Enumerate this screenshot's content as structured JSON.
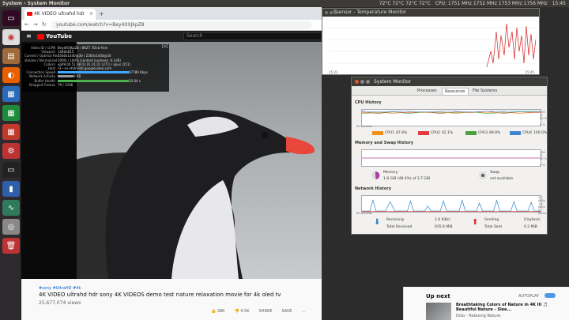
{
  "topbar": {
    "title": "System › System Monitor",
    "tray": [
      "72°C 72°C 72°C 72°C",
      "CPU: 1751 MHz 1752 MHz 1753 MHz 1756 MHz",
      "15:45"
    ]
  },
  "launcher": {
    "items": [
      "terminal",
      "chrome",
      "files",
      "firefox",
      "libreoffice-writer",
      "libreoffice-calc",
      "libreoffice-impress",
      "settings",
      "terminal-2",
      "sysmon",
      "terminal-3",
      "camera",
      "trash"
    ]
  },
  "browser": {
    "tab_title": "4K VIDEO ultrahd hdr",
    "url": "youtube.com/watch?v=Bey4XXJkpZ8",
    "yt_logo": "YouTube",
    "search_placeholder": "Search",
    "stats": [
      {
        "k": "Video ID / sCPN",
        "v": "Bey4XXJkpZ8 / 8KZT 7Dnb 9nm"
      },
      {
        "k": "Viewport",
        "v": "1440x815"
      },
      {
        "k": "Current / Optimal Res",
        "v": "2560x1440@30 / 2560x1440@30"
      },
      {
        "k": "Volume / Normalized",
        "v": "100% / 100% (content loudness -0.1dB)"
      },
      {
        "k": "Codecs",
        "v": "vp09.00.51.08.01.01.01.01 (271) / opus (251)"
      },
      {
        "k": "Host",
        "v": "r3---sn-xfxtn-9jtl.googlevideo.com"
      },
      {
        "k": "Connection Speed",
        "v": "97789 Kbps"
      },
      {
        "k": "Network Activity",
        "v": "0 KB"
      },
      {
        "k": "Buffer Health",
        "v": "30.84 s"
      },
      {
        "k": "Dropped Frames",
        "v": "79 / 1336"
      }
    ],
    "tags": "#sony #UltraHD #4k",
    "video_title": "4K VIDEO ultrahd hdr sony 4K VIDEOS demo test nature relaxation movie for 4k oled tv",
    "views": "25,677,074 views",
    "actions": [
      "👍 38K",
      "👎 4.5K",
      "SHARE",
      "SAVE",
      "..."
    ],
    "upnext": {
      "header": "Up next",
      "autoplay": "AUTOPLAY",
      "title": "Breathtaking Colors of Nature in 4K III 🎵 Beautiful Nature - Slee...",
      "channel": "Dolo - Relaxing Nature"
    }
  },
  "psensor": {
    "title": "Psensor - Temperature Monitor",
    "time_start": "15:21",
    "time_end": "15:45"
  },
  "sysmon": {
    "title": "System Monitor",
    "tabs": [
      "Processes",
      "Resources",
      "File Systems"
    ],
    "active_tab": "Resources",
    "cpu_section": "CPU History",
    "cpu_axis": [
      "100 %",
      "50 %",
      "0 %"
    ],
    "cpu_legend": [
      {
        "label": "CPU1",
        "value": "87.8%",
        "color": "#ef8f19"
      },
      {
        "label": "CPU2",
        "value": "92.1%",
        "color": "#e0393e"
      },
      {
        "label": "CPU3",
        "value": "89.8%",
        "color": "#4ea03d"
      },
      {
        "label": "CPU4",
        "value": "100.0%",
        "color": "#3f84d0"
      }
    ],
    "mem_section": "Memory and Swap History",
    "mem_axis": [
      "100 %",
      "50 %",
      "0 %"
    ],
    "memory": {
      "label": "Memory",
      "value": "1.8 GiB (48.4%) of 3.7 GiB"
    },
    "swap": {
      "label": "Swap",
      "value": "not available"
    },
    "net_section": "Network History",
    "net_axis": [
      "2.0 KiB/s",
      "1.0 KiB/s",
      "0 bytes/s"
    ],
    "x_labels": [
      "60 seconds",
      "50",
      "40",
      "30",
      "20",
      "10"
    ],
    "receiving": {
      "label": "Receiving",
      "value": "1.6 KiB/s",
      "total_label": "Total Received",
      "total": "935.6 MiB"
    },
    "sending": {
      "label": "Sending",
      "value": "0 bytes/s",
      "total_label": "Total Sent",
      "total": "0.2 MiB"
    }
  }
}
